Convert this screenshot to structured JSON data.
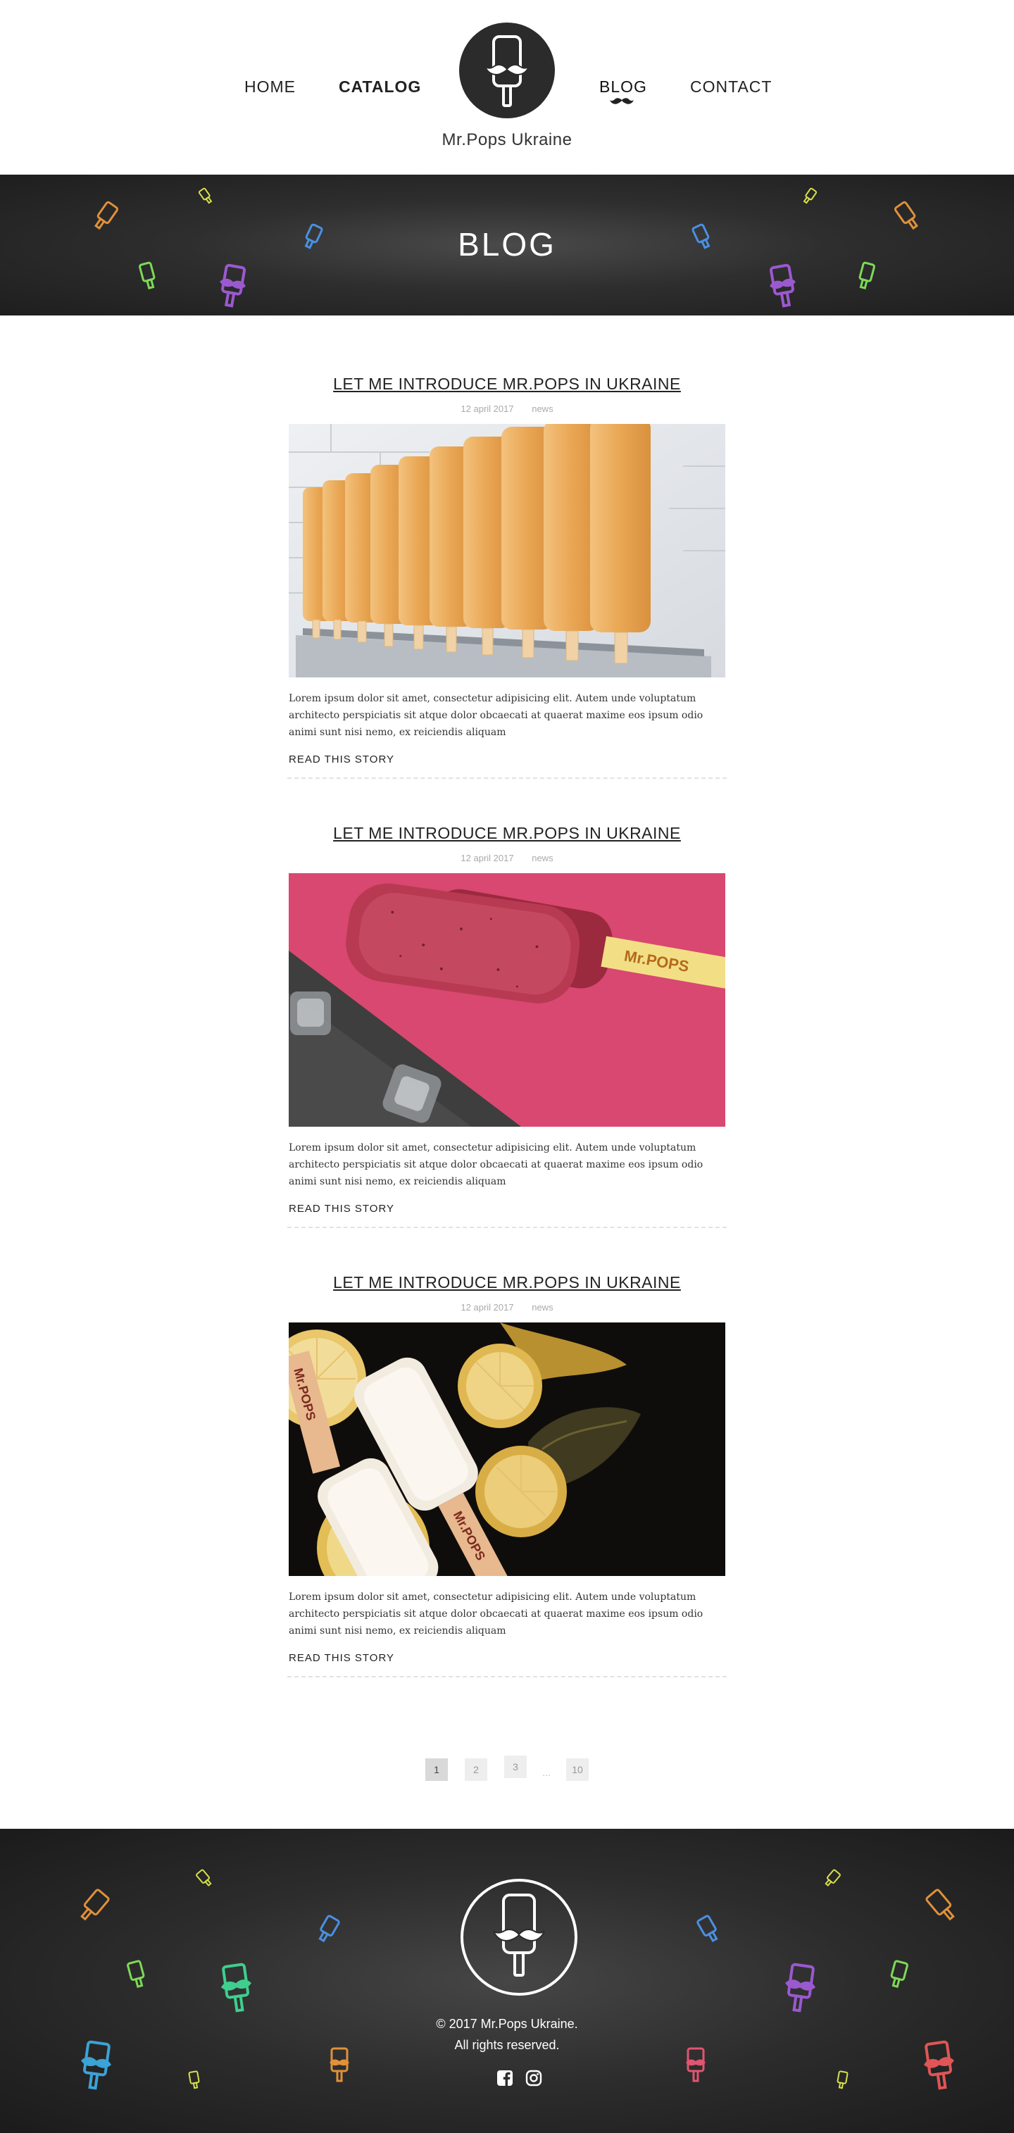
{
  "nav": {
    "home": "HOME",
    "catalog": "CATALOG",
    "blog": "BLOG",
    "contact": "CONTACT"
  },
  "brand": {
    "name": "Mr.Pops Ukraine"
  },
  "banner": {
    "title": "BLOG"
  },
  "posts": [
    {
      "title": "LET ME INTRODUCE MR.POPS IN UKRAINE",
      "date": "12 april 2017",
      "category": "news",
      "excerpt": "Lorem ipsum dolor sit amet, consectetur adipisicing elit. Autem unde voluptatum architecto perspiciatis sit atque dolor obcaecati at quaerat maxime eos ipsum odio animi sunt nisi nemo, ex reiciendis aliquam",
      "read_more": "READ THIS STORY"
    },
    {
      "title": "LET ME INTRODUCE MR.POPS IN UKRAINE",
      "date": "12 april 2017",
      "category": "news",
      "excerpt": "Lorem ipsum dolor sit amet, consectetur adipisicing elit. Autem unde voluptatum architecto perspiciatis sit atque dolor obcaecati at quaerat maxime eos ipsum odio animi sunt nisi nemo, ex reiciendis aliquam",
      "read_more": "READ THIS STORY",
      "stick_text": "Mr.POPS"
    },
    {
      "title": "LET ME INTRODUCE MR.POPS IN UKRAINE",
      "date": "12 april 2017",
      "category": "news",
      "excerpt": "Lorem ipsum dolor sit amet, consectetur adipisicing elit. Autem unde voluptatum architecto perspiciatis sit atque dolor obcaecati at quaerat maxime eos ipsum odio animi sunt nisi nemo, ex reiciendis aliquam",
      "read_more": "READ THIS STORY",
      "stick_text": "Mr.POPS"
    }
  ],
  "pagination": {
    "pages": [
      "1",
      "2",
      "3"
    ],
    "ellipsis": "...",
    "last": "10",
    "active": "1"
  },
  "footer": {
    "copyright_line1": "© 2017 Mr.Pops Ukraine.",
    "copyright_line2": "All rights reserved.",
    "social": [
      "facebook-icon",
      "instagram-icon"
    ]
  },
  "colors": {
    "dark_bg": "#2b2b2b",
    "pop_orange": "#e0913a",
    "pop_green": "#7ed957",
    "pop_purple": "#9b59d0",
    "pop_blue": "#4a90e2",
    "pop_yellow": "#d9e04a",
    "pop_teal": "#3ecf8e",
    "pop_red": "#e05555"
  }
}
